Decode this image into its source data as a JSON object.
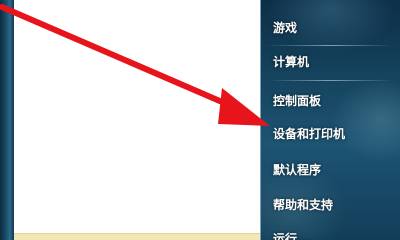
{
  "start_menu": {
    "right_pane": {
      "items": [
        {
          "label": "游戏"
        },
        {
          "label": "计算机"
        },
        {
          "label": "控制面板"
        },
        {
          "label": "设备和打印机"
        },
        {
          "label": "默认程序"
        },
        {
          "label": "帮助和支持"
        },
        {
          "label": "运行..."
        }
      ]
    }
  },
  "annotation": {
    "arrow_color": "#e8141b",
    "points_to": "设备和打印机"
  }
}
